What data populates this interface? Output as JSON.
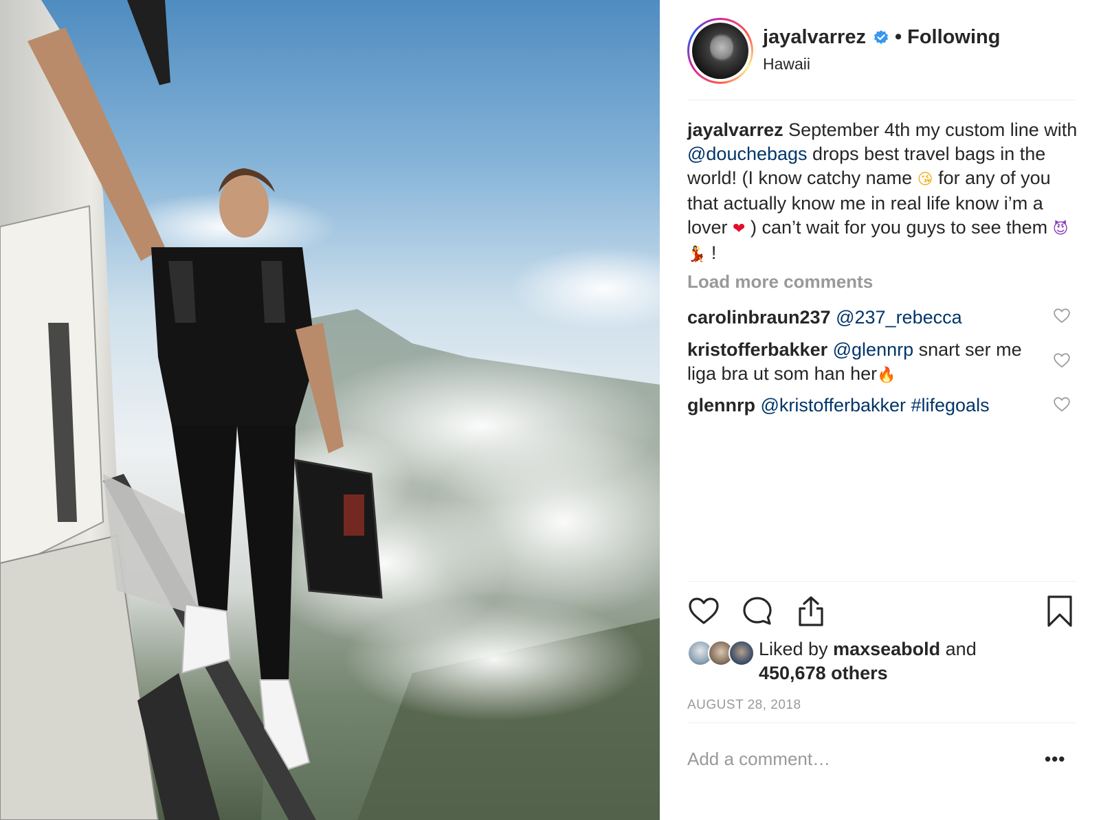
{
  "post": {
    "username": "jayalvarrez",
    "separator": "•",
    "follow_status": "Following",
    "location": "Hawaii"
  },
  "caption": {
    "author": "jayalvarrez",
    "t1": " September 4th my custom line with ",
    "mention": "@douchebags",
    "t2": " drops best travel bags in the world! (I know catchy name ",
    "emoji_kiss": "😘",
    "t3": "  for any of you that actually know me in real life know i’m a lover ",
    "emoji_heart": "❤",
    "t4": " ) can’t wait for you guys to see them ",
    "emoji_devil": "😈",
    "emoji_dancer": "💃",
    "t5": " !"
  },
  "load_more": "Load more comments",
  "comments": [
    {
      "user": "carolinbraun237",
      "mention": "@237_rebecca",
      "text": ""
    },
    {
      "user": "kristofferbakker",
      "mention": "@glennrp",
      "text": " snart ser me liga bra ut som han her",
      "emoji": "🔥"
    },
    {
      "user": "glennrp",
      "mention": "@kristofferbakker #lifegoals",
      "text": ""
    }
  ],
  "likes": {
    "prefix": "Liked by ",
    "user": "maxseabold",
    "middle": " and",
    "count": "450,678 others"
  },
  "date": "AUGUST 28, 2018",
  "add_comment_placeholder": "Add a comment…",
  "more_label": "•••",
  "colors": {
    "text": "#262626",
    "mention": "#003569",
    "muted": "#999999",
    "verified": "#3897f0"
  },
  "icons": {
    "like": "heart-outline-icon",
    "comment": "speech-bubble-icon",
    "share": "share-icon",
    "save": "bookmark-icon",
    "verified": "verified-badge-icon"
  }
}
